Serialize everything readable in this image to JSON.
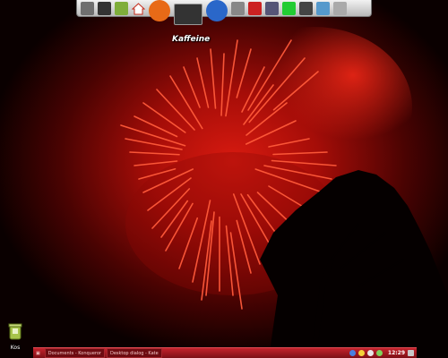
{
  "dock": {
    "items": [
      {
        "name": "tools-icon"
      },
      {
        "name": "terminal-icon"
      },
      {
        "name": "package-icon"
      },
      {
        "name": "home-icon"
      },
      {
        "name": "firefox-icon"
      },
      {
        "name": "kaffeine-icon"
      },
      {
        "name": "browser-icon"
      },
      {
        "name": "media-icon"
      },
      {
        "name": "calendar-icon"
      },
      {
        "name": "settings-icon"
      },
      {
        "name": "monitor-icon"
      },
      {
        "name": "system-icon"
      },
      {
        "name": "network-icon"
      },
      {
        "name": "exit-icon"
      }
    ],
    "hover_label": "Kaffeine"
  },
  "desktop": {
    "trash_label": "Kos"
  },
  "panel": {
    "tasks": [
      {
        "label": "Documents - Konqueror"
      },
      {
        "label": "Desktop dialog - Kate"
      }
    ],
    "clock": "12:29"
  },
  "colors": {
    "panel": "#a51a22",
    "spark": "#ff3a2a"
  }
}
